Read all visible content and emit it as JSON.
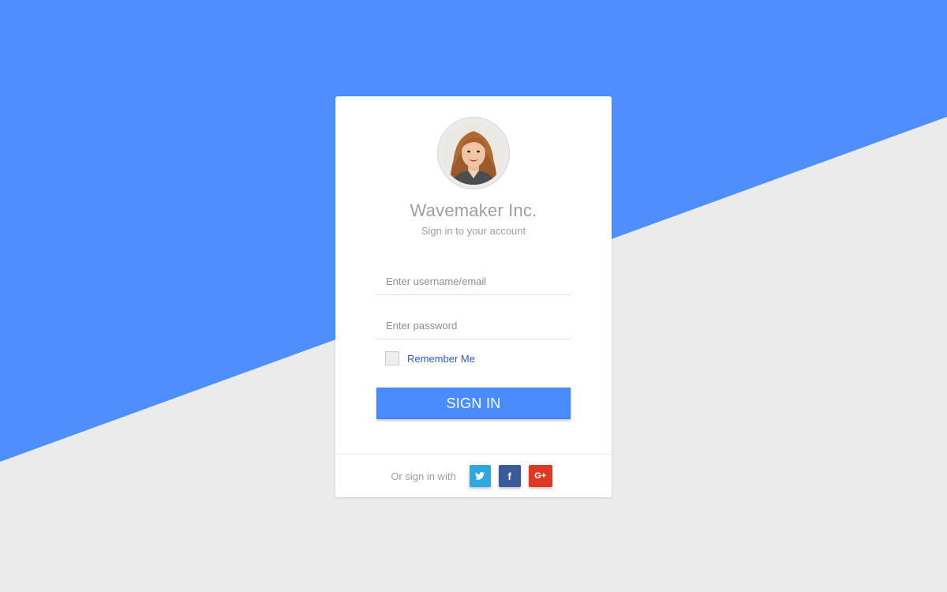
{
  "brand": {
    "title": "Wavemaker Inc.",
    "subtitle": "Sign in to your account"
  },
  "form": {
    "username_placeholder": "Enter username/email",
    "password_placeholder": "Enter password",
    "remember_label": "Remember Me",
    "remember_checked": false,
    "submit_label": "SIGN IN"
  },
  "social": {
    "label": "Or sign in with",
    "buttons": [
      {
        "name": "twitter",
        "icon": "twitter-icon",
        "color": "#2fa8e0"
      },
      {
        "name": "facebook",
        "icon": "facebook-icon",
        "glyph": "f",
        "color": "#3b5a9a"
      },
      {
        "name": "google-plus",
        "icon": "google-plus-icon",
        "glyph": "G+",
        "color": "#dd3a25"
      }
    ]
  },
  "colors": {
    "accent": "#4a8cff",
    "background_top": "#4e8ffd",
    "background_bottom": "#ebebeb",
    "link": "#2a5bd0"
  }
}
